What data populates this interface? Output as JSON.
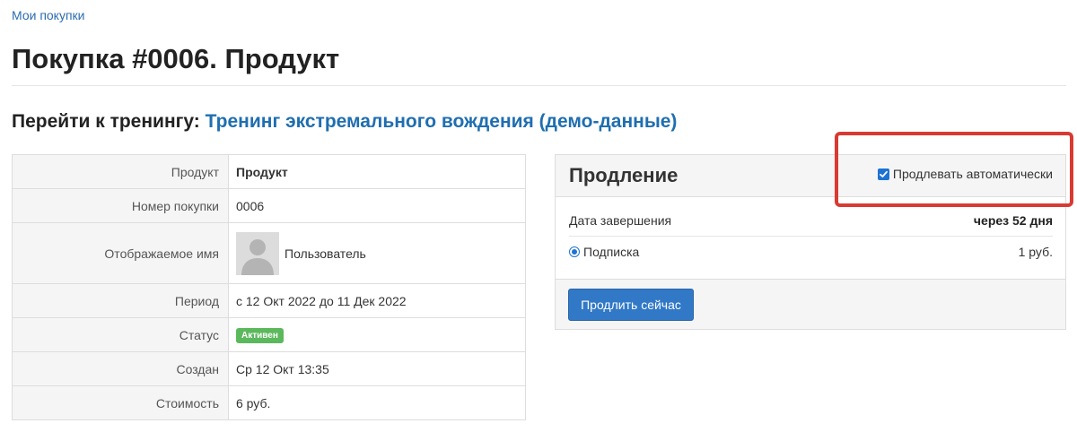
{
  "breadcrumb": {
    "label": "Мои покупки"
  },
  "page": {
    "title": "Покупка #0006. Продукт"
  },
  "training": {
    "prefix": "Перейти к тренингу:",
    "link": "Тренинг экстремального вождения (демо-данные)"
  },
  "details": {
    "product": {
      "label": "Продукт",
      "value": "Продукт"
    },
    "number": {
      "label": "Номер покупки",
      "value": "0006"
    },
    "display_name": {
      "label": "Отображаемое имя",
      "value": "Пользователь"
    },
    "period": {
      "label": "Период",
      "value": "с 12 Окт 2022 до 11 Дек 2022"
    },
    "status": {
      "label": "Статус",
      "value": "Активен"
    },
    "created": {
      "label": "Создан",
      "value": "Ср 12 Окт 13:35"
    },
    "cost": {
      "label": "Стоимость",
      "value": "6 руб."
    }
  },
  "renewal": {
    "title": "Продление",
    "auto_renew_label": "Продлевать автоматически",
    "auto_renew_checked": true,
    "end_date_label": "Дата завершения",
    "end_date_value": "через 52 дня",
    "plan_label": "Подписка",
    "plan_selected": true,
    "plan_price": "1 руб.",
    "renew_button": "Продлить сейчас"
  },
  "colors": {
    "link": "#1f6eb0",
    "accent": "#3178c6",
    "status_active": "#5cb85c",
    "highlight": "#d93a32"
  },
  "icons": {
    "avatar": "user-silhouette-icon",
    "checkbox": "checkbox-checked-icon",
    "radio": "radio-selected-icon"
  }
}
